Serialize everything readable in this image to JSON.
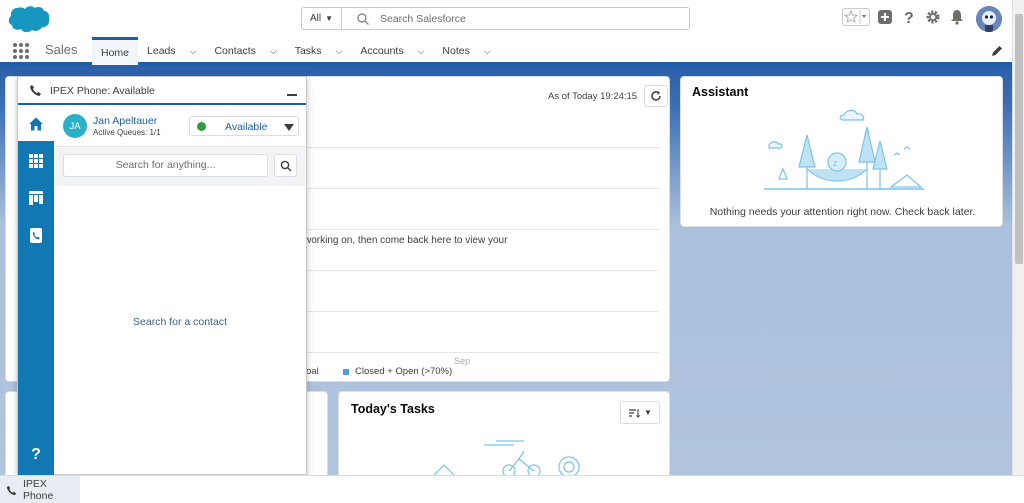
{
  "header": {
    "search_scope": "All",
    "search_placeholder": "Search Salesforce"
  },
  "nav": {
    "app_name": "Sales",
    "items": [
      {
        "label": "Home",
        "active": true
      },
      {
        "label": "Leads"
      },
      {
        "label": "Contacts"
      },
      {
        "label": "Tasks"
      },
      {
        "label": "Accounts"
      },
      {
        "label": "Notes"
      }
    ]
  },
  "performance": {
    "as_of": "As of Today 19:24:15",
    "message": "working on, then come back here to view your",
    "x_tick": "Sep",
    "legend_goal": "oal",
    "legend_closed": "Closed + Open (>70%)"
  },
  "assistant": {
    "title": "Assistant",
    "message": "Nothing needs your attention right now. Check back later."
  },
  "tasks": {
    "title": "Today's Tasks"
  },
  "phone": {
    "title": "IPEX Phone: Available",
    "agent_initials": "JA",
    "agent_name": "Jan Apeltauer",
    "agent_queues": "Active Queues: 1/1",
    "status": "Available",
    "status_color": "#2e9e3f",
    "search_placeholder": "Search for anything...",
    "empty_message": "Search for a contact"
  },
  "utility_bar": {
    "item_label": "IPEX Phone"
  },
  "colors": {
    "brand_blue": "#1b5fa8",
    "phone_sidebar": "#1178b4",
    "cloud_blue": "#1797c0"
  }
}
